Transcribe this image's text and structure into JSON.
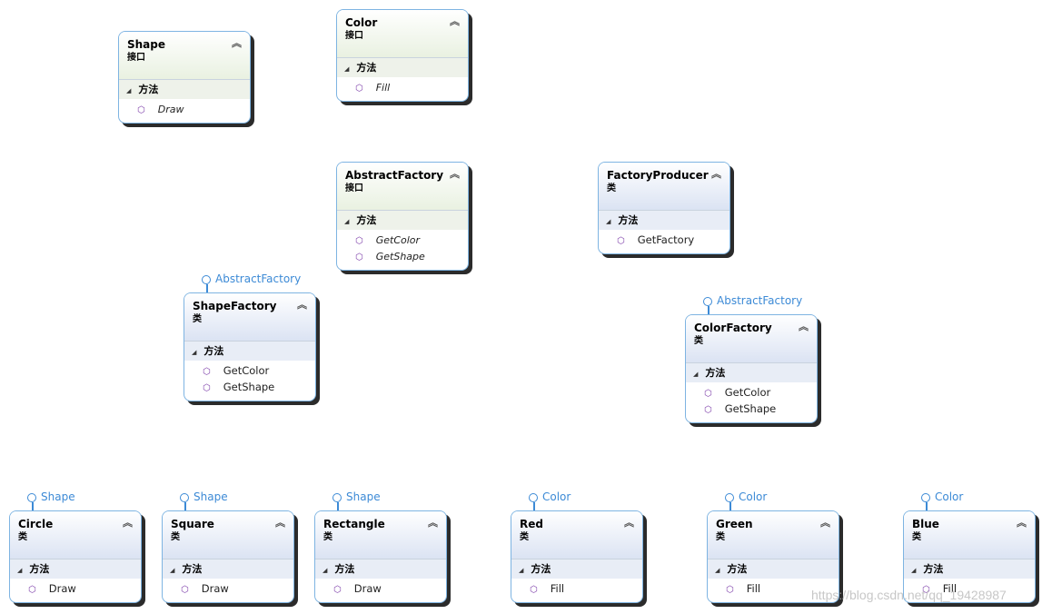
{
  "section_label": "方法",
  "collapse_icon": "double-chevron-up-icon",
  "method_icon": "method-cube-icon",
  "colors": {
    "border": "#7eb4e2",
    "interface_header": "#e9f1e1",
    "class_header": "#dbe3f3",
    "lollipop": "#3c8ad6",
    "method_icon": "#7a3aa8"
  },
  "shapes": [
    {
      "name": "Shape",
      "kind": "接口",
      "type": "interface",
      "methods": [
        "Draw"
      ]
    },
    {
      "name": "Color",
      "kind": "接口",
      "type": "interface",
      "methods": [
        "Fill"
      ]
    },
    {
      "name": "AbstractFactory",
      "kind": "接口",
      "type": "interface",
      "methods": [
        "GetColor",
        "GetShape"
      ]
    },
    {
      "name": "FactoryProducer",
      "kind": "类",
      "type": "class",
      "methods": [
        "GetFactory"
      ]
    },
    {
      "name": "ShapeFactory",
      "kind": "类",
      "type": "class",
      "implements": "AbstractFactory",
      "methods": [
        "GetColor",
        "GetShape"
      ]
    },
    {
      "name": "ColorFactory",
      "kind": "类",
      "type": "class",
      "implements": "AbstractFactory",
      "methods": [
        "GetColor",
        "GetShape"
      ]
    },
    {
      "name": "Circle",
      "kind": "类",
      "type": "class",
      "implements": "Shape",
      "methods": [
        "Draw"
      ]
    },
    {
      "name": "Square",
      "kind": "类",
      "type": "class",
      "implements": "Shape",
      "methods": [
        "Draw"
      ]
    },
    {
      "name": "Rectangle",
      "kind": "类",
      "type": "class",
      "implements": "Shape",
      "methods": [
        "Draw"
      ]
    },
    {
      "name": "Red",
      "kind": "类",
      "type": "class",
      "implements": "Color",
      "methods": [
        "Fill"
      ]
    },
    {
      "name": "Green",
      "kind": "类",
      "type": "class",
      "implements": "Color",
      "methods": [
        "Fill"
      ]
    },
    {
      "name": "Blue",
      "kind": "类",
      "type": "class",
      "implements": "Color",
      "methods": [
        "Fill"
      ]
    }
  ],
  "watermark": "https://blog.csdn.net/qq_19428987"
}
